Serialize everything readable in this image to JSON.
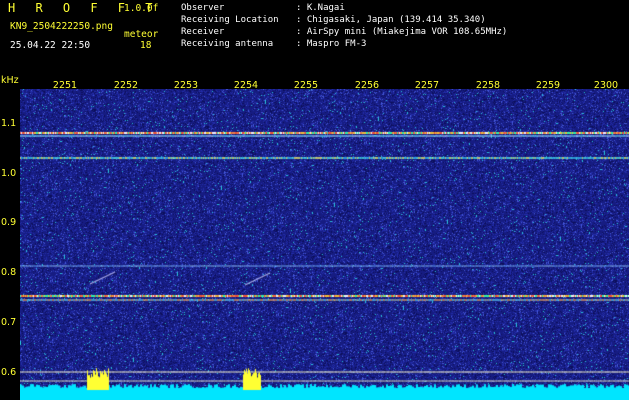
{
  "logo": {
    "text": "H R O F F T",
    "version": "1.0.0f"
  },
  "file": {
    "name": "KN9_2504222250.png",
    "datetime": "25.04.22 22:50",
    "meteor_label": "meteor",
    "meteor_count": "18"
  },
  "meta": [
    {
      "label": "Observer",
      "value": ": K.Nagai"
    },
    {
      "label": "Receiving Location",
      "value": ": Chigasaki, Japan (139.414 35.340)"
    },
    {
      "label": "Receiver",
      "value": ": AirSpy mini (Miakejima VOR 108.65MHz)"
    },
    {
      "label": "Receiving antenna",
      "value": ": Maspro FM-3"
    }
  ],
  "axis": {
    "y_unit": "kHz",
    "x_ticks": [
      "2251",
      "2252",
      "2253",
      "2254",
      "2255",
      "2256",
      "2257",
      "2258",
      "2259",
      "2300"
    ],
    "y_ticks": [
      "1.1",
      "1.0",
      "0.9",
      "0.8",
      "0.7",
      "0.6"
    ]
  },
  "colors": {
    "background": "#1a1f8c",
    "label": "#ffff33",
    "signal": "#ff5533",
    "noise_floor": "#00e5ff"
  }
}
